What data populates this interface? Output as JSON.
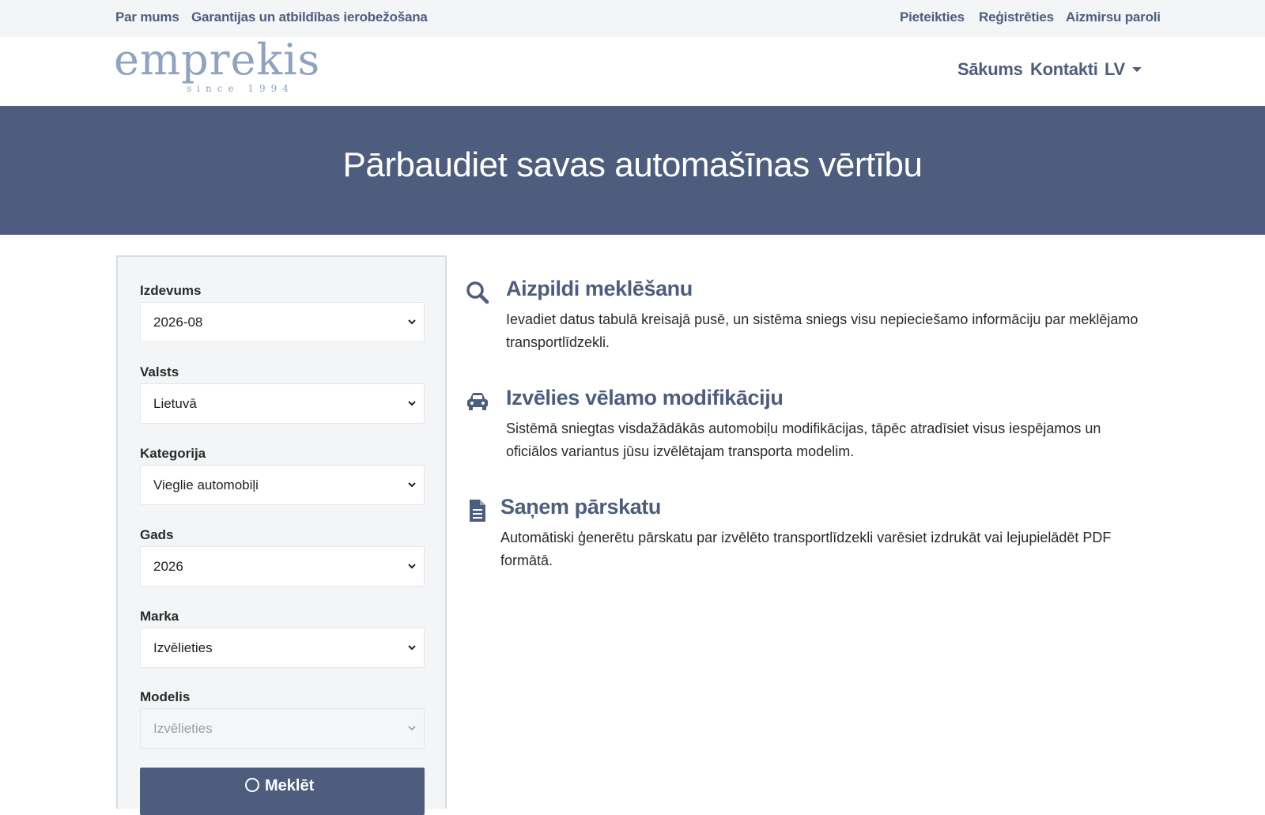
{
  "topbar": {
    "left_links": [
      "Par mums",
      "Garantijas un atbildības ierobežošana"
    ],
    "right_links": [
      "Pieteikties",
      "Reģistrēties",
      "Aizmirsu paroli"
    ]
  },
  "navbar": {
    "logo": {
      "word": "emprekis",
      "since": "since 1994"
    },
    "links": [
      "Sākums",
      "Kontakti"
    ],
    "language": "LV"
  },
  "hero": {
    "title": "Pārbaudiet savas automašīnas vērtību"
  },
  "search_form": {
    "fields": [
      {
        "label": "Izdevums",
        "value": "2026-08",
        "disabled": false
      },
      {
        "label": "Valsts",
        "value": "Lietuvā",
        "disabled": false
      },
      {
        "label": "Kategorija",
        "value": "Vieglie automobiļi",
        "disabled": false
      },
      {
        "label": "Gads",
        "value": "2026",
        "disabled": false
      },
      {
        "label": "Marka",
        "value": "Izvēlieties",
        "disabled": false
      },
      {
        "label": "Modelis",
        "value": "Izvēlieties",
        "disabled": true
      }
    ],
    "button_label": "Meklēt"
  },
  "features": [
    {
      "icon": "search-icon",
      "title": "Aizpildi meklēšanu",
      "text": "Ievadiet datus tabulā kreisajā pusē, un sistēma sniegs visu nepieciešamo informāciju par meklējamo transportlīdzekli."
    },
    {
      "icon": "car-icon",
      "title": "Izvēlies vēlamo modifikāciju",
      "text": "Sistēmā sniegtas visdažādākās automobiļu modifikācijas, tāpēc atradīsiet visus iespējamos un oficiālos variantus jūsu izvēlētajam transporta modelim."
    },
    {
      "icon": "document-icon",
      "title": "Saņem pārskatu",
      "text": "Automātiski ģenerētu pārskatu par izvēlēto transportlīdzekli varēsiet izdrukāt vai lejupielādēt PDF formātā."
    }
  ],
  "colors": {
    "brand": "#4e5d7d",
    "logo": "#8fa3bf",
    "topbar_bg": "#f3f5f7",
    "panel_bg": "#f3f5f7"
  }
}
